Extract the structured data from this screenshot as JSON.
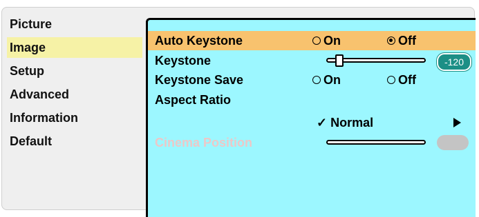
{
  "menu": {
    "items": [
      {
        "label": "Picture"
      },
      {
        "label": "Image"
      },
      {
        "label": "Setup"
      },
      {
        "label": "Advanced"
      },
      {
        "label": "Information"
      },
      {
        "label": "Default"
      }
    ],
    "active_index": 1
  },
  "panel": {
    "auto_keystone": {
      "label": "Auto Keystone",
      "on_label": "On",
      "off_label": "Off",
      "selected": "Off"
    },
    "keystone": {
      "label": "Keystone",
      "value": "-120",
      "level": 0.1
    },
    "keystone_save": {
      "label": "Keystone Save",
      "on_label": "On",
      "off_label": "Off",
      "selected": "none"
    },
    "aspect_ratio": {
      "label": "Aspect Ratio",
      "value": "Normal",
      "check": "✓"
    },
    "cinema_position": {
      "label": "Cinema Position",
      "enabled": false
    }
  },
  "colors": {
    "panel_bg": "#9cf7ff",
    "selected_row": "#f8c26e",
    "active_menu": "#f6f2a6",
    "value_pill": "#1c8f86"
  }
}
